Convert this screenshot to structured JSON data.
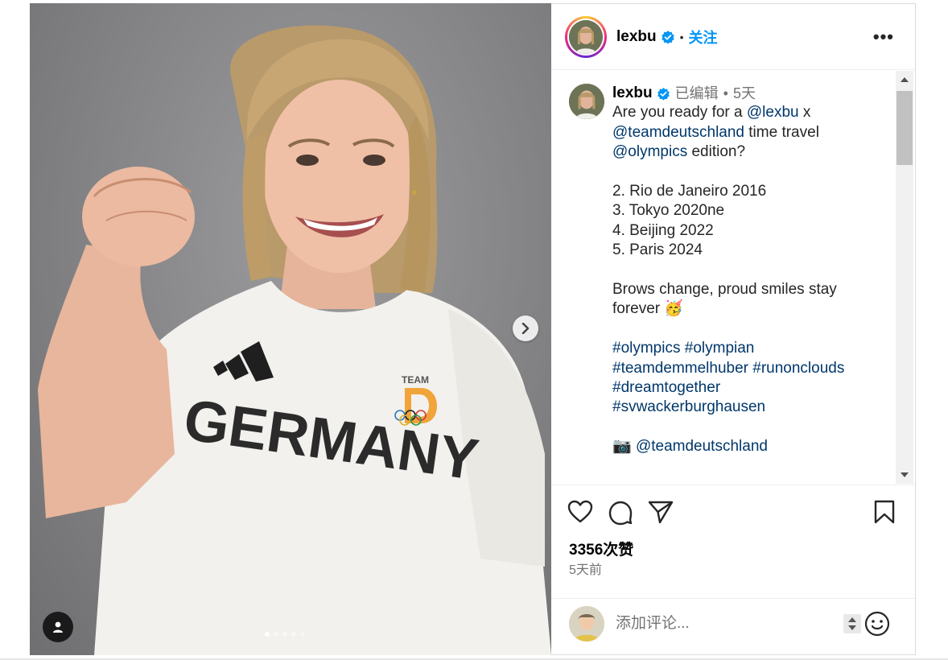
{
  "post": {
    "username": "lexbu",
    "follow_label": "关注",
    "more_label": "•••",
    "verified_icon": "verified-badge-icon"
  },
  "caption": {
    "username": "lexbu",
    "edited": "已编辑",
    "dot": "•",
    "time": "5天",
    "intro_1": "Are you ready for a ",
    "mention_lexbu": "@lexbu",
    "intro_x": " x",
    "mention_team": "@teamdeutschland",
    "intro_2": " time travel",
    "mention_olympics": "@olympics",
    "intro_3": " edition?",
    "list": [
      "2. Rio de Janeiro 2016",
      "3. Tokyo 2020ne",
      "4. Beijing 2022",
      "5. Paris 2024"
    ],
    "brows_1": "Brows change, proud smiles stay",
    "brows_2": "forever",
    "emoji": "🥳",
    "hashtags_line1": [
      "#olympics",
      "#olympian"
    ],
    "hashtags_line2": [
      "#teamdemmelhuber",
      "#runonclouds"
    ],
    "hashtags_line3": [
      "#dreamtogether"
    ],
    "hashtags_line4": [
      "#svwackerburghausen"
    ],
    "camera_emoji": "📷",
    "photo_credit": "@teamdeutschland"
  },
  "photo": {
    "shirt_text": "GERMANY",
    "team_text": "TEAM",
    "carousel_total": 5,
    "carousel_active": 1
  },
  "actions": {
    "likes": "3356次赞",
    "ago": "5天前",
    "comment_placeholder": "添加评论..."
  },
  "colors": {
    "link": "#00376b",
    "follow": "#0095f6",
    "verified": "#0095f6",
    "muted": "#737373"
  }
}
